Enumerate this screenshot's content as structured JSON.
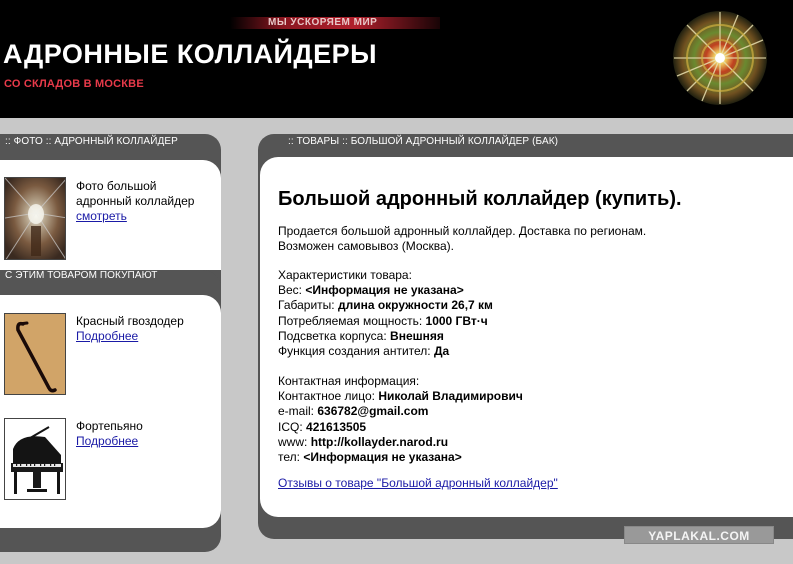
{
  "header": {
    "tagline": "МЫ УСКОРЯЕМ МИР",
    "title": "АДРОННЫЕ КОЛЛАЙДЕРЫ",
    "subtitle": "СО СКЛАДОВ В МОСКВЕ",
    "logo_icon": "collider-logo-icon"
  },
  "sidebar": {
    "photo_section": {
      "title": ":: ФОТО :: АДРОННЫЙ КОЛЛАЙДЕР",
      "item": {
        "image_icon": "collider-tunnel-photo",
        "text": "Фото большой адронный коллайдер",
        "link": "смотреть"
      }
    },
    "related_section": {
      "title": "С ЭТИМ ТОВАРОМ ПОКУПАЮТ",
      "items": [
        {
          "image_icon": "crowbar-photo",
          "name": "Красный гвоздодер",
          "link": "Подробнее"
        },
        {
          "image_icon": "piano-photo",
          "name": "Фортепьяно",
          "link": "Подробнее"
        }
      ]
    }
  },
  "main": {
    "breadcrumb": ":: ТОВАРЫ :: БОЛЬШОЙ АДРОННЫЙ КОЛЛАЙДЕР (БАК)",
    "heading": "Большой адронный коллайдер (купить).",
    "description": [
      "Продается большой адронный коллайдер. Доставка по регионам.",
      "Возможен самовывоз (Москва)."
    ],
    "specs": {
      "title": "Характеристики товара:",
      "rows": [
        {
          "label": "Вес:",
          "value": "<Информация не указана>"
        },
        {
          "label": "Габариты:",
          "value": "длина окружности 26,7 км"
        },
        {
          "label": "Потребляемая мощность:",
          "value": "1000 ГВт·ч"
        },
        {
          "label": "Подсветка корпуса:",
          "value": "Внешняя"
        },
        {
          "label": "Функция создания антител:",
          "value": "Да"
        }
      ]
    },
    "contacts": {
      "title": "Контактная информация:",
      "rows": [
        {
          "label": "Контактное лицо:",
          "value": "Николай Владимирович"
        },
        {
          "label": "e-mail:",
          "value": "636782@gmail.com"
        },
        {
          "label": "ICQ:",
          "value": "421613505"
        },
        {
          "label": "www:",
          "value": "http://kollayder.narod.ru"
        },
        {
          "label": "тел:",
          "value": "<Информация не указана>"
        }
      ]
    },
    "reviews_link": "Отзывы о товаре \"Большой адронный коллайдер\""
  },
  "watermark": "YAPLAKAL.COM"
}
